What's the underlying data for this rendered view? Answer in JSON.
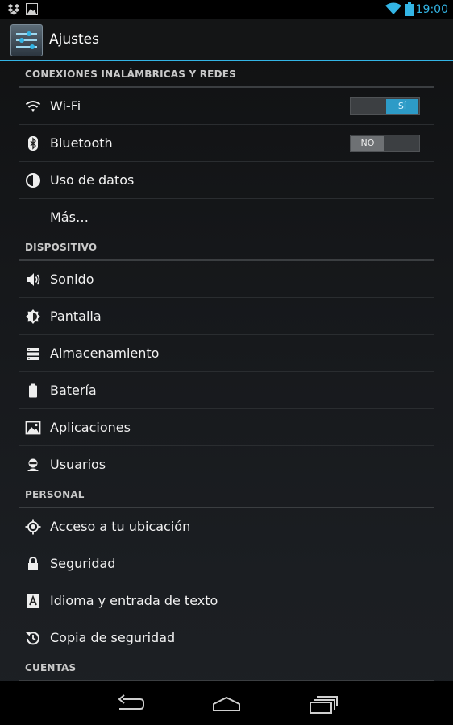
{
  "status_bar": {
    "time": "19:00",
    "left_icons": [
      "dropbox-icon",
      "image-icon"
    ],
    "right_icons": [
      "wifi-icon",
      "battery-icon"
    ],
    "accent_color": "#33b5e5"
  },
  "action_bar": {
    "title": "Ajustes",
    "app_icon": "settings-sliders-icon"
  },
  "sections": {
    "wireless": {
      "header": "CONEXIONES INALÁMBRICAS Y REDES",
      "items": [
        {
          "label": "Wi-Fi",
          "icon": "wifi-icon",
          "toggle": {
            "state": "on",
            "text": "SÍ"
          }
        },
        {
          "label": "Bluetooth",
          "icon": "bluetooth-icon",
          "toggle": {
            "state": "off",
            "text": "NO"
          }
        },
        {
          "label": "Uso de datos",
          "icon": "data-usage-icon"
        },
        {
          "label": "Más…",
          "icon": ""
        }
      ]
    },
    "device": {
      "header": "DISPOSITIVO",
      "items": [
        {
          "label": "Sonido",
          "icon": "speaker-icon"
        },
        {
          "label": "Pantalla",
          "icon": "brightness-icon"
        },
        {
          "label": "Almacenamiento",
          "icon": "storage-icon"
        },
        {
          "label": "Batería",
          "icon": "battery-icon"
        },
        {
          "label": "Aplicaciones",
          "icon": "apps-icon"
        },
        {
          "label": "Usuarios",
          "icon": "user-icon"
        }
      ]
    },
    "personal": {
      "header": "PERSONAL",
      "items": [
        {
          "label": "Acceso a tu ubicación",
          "icon": "location-icon"
        },
        {
          "label": "Seguridad",
          "icon": "lock-icon"
        },
        {
          "label": "Idioma y entrada de texto",
          "icon": "keyboard-a-icon"
        },
        {
          "label": "Copia de seguridad",
          "icon": "backup-icon"
        }
      ]
    },
    "accounts": {
      "header": "CUENTAS"
    }
  },
  "nav_bar": {
    "buttons": [
      "back-icon",
      "home-icon",
      "recent-apps-icon"
    ]
  }
}
